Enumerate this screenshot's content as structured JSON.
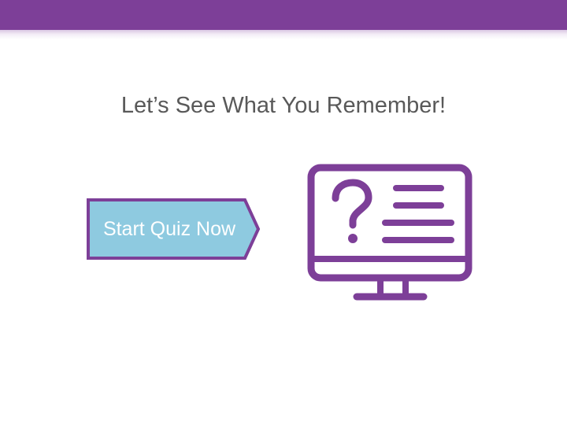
{
  "slide": {
    "title": "Let’s See What You Remember!"
  },
  "start_button": {
    "label": "Start Quiz Now"
  },
  "icons": {
    "monitor": "computer-monitor-quiz-icon"
  },
  "colors": {
    "brand_purple": "#7d3f98",
    "button_fill": "#8ecae0",
    "title_text": "#595959",
    "button_text": "#ffffff"
  }
}
